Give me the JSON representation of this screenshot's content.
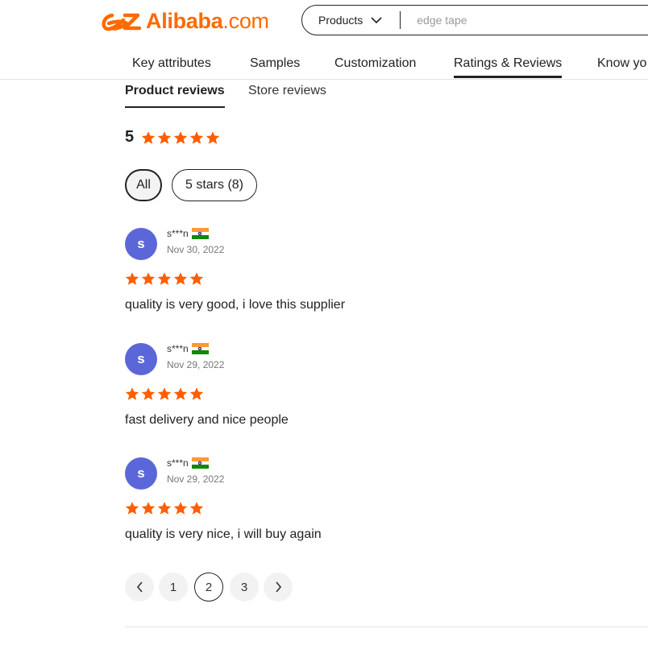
{
  "header": {
    "logo_brand": "Alibaba",
    "logo_domain": ".com",
    "search_category": "Products",
    "search_placeholder": "edge tape"
  },
  "nav": {
    "items": [
      "Key attributes",
      "Samples",
      "Customization",
      "Ratings & Reviews",
      "Know yo"
    ],
    "active": "Ratings & Reviews"
  },
  "tabs": {
    "product_reviews": "Product reviews",
    "store_reviews": "Store reviews"
  },
  "summary": {
    "rating": "5",
    "stars": 5
  },
  "filters": {
    "all": "All",
    "five_stars": "5 stars (8)"
  },
  "reviews": [
    {
      "initial": "s",
      "user": "s***n",
      "country_flag": "India",
      "date": "Nov 30, 2022",
      "stars": 5,
      "text": "quality is very good, i love this supplier"
    },
    {
      "initial": "s",
      "user": "s***n",
      "country_flag": "India",
      "date": "Nov 29, 2022",
      "stars": 5,
      "text": "fast delivery and nice people"
    },
    {
      "initial": "s",
      "user": "s***n",
      "country_flag": "India",
      "date": "Nov 29, 2022",
      "stars": 5,
      "text": "quality is very nice, i will buy again"
    }
  ],
  "pagination": {
    "pages": [
      "1",
      "2",
      "3"
    ],
    "current": "2"
  },
  "colors": {
    "brand": "#ff6a00",
    "star": "#ff5f00",
    "avatar": "#5b67d8"
  }
}
